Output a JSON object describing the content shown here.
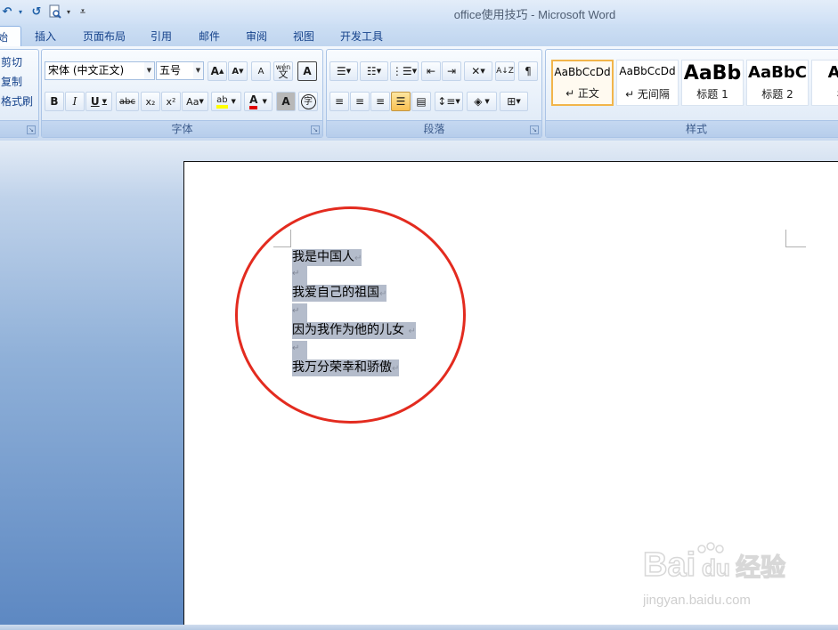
{
  "app": {
    "title": "office使用技巧 - Microsoft Word"
  },
  "tabs": [
    {
      "label": "始"
    },
    {
      "label": "插入"
    },
    {
      "label": "页面布局"
    },
    {
      "label": "引用"
    },
    {
      "label": "邮件"
    },
    {
      "label": "审阅"
    },
    {
      "label": "视图"
    },
    {
      "label": "开发工具"
    }
  ],
  "clipboard": {
    "cut": "剪切",
    "copy": "复制",
    "format_painter": "格式刷"
  },
  "font_group": {
    "label": "字体",
    "font_name": "宋体 (中文正文)",
    "font_size": "五号",
    "grow": "A",
    "shrink": "A",
    "clear_format": "A",
    "phonetic": "wén",
    "bold": "B",
    "italic": "I",
    "underline": "U",
    "strike": "abc",
    "subscript": "x₂",
    "superscript": "x²",
    "change_case": "Aa",
    "highlight": "ab",
    "font_color": "A",
    "char_shading": "A",
    "enclose": "字"
  },
  "paragraph_group": {
    "label": "段落"
  },
  "styles_group": {
    "label": "样式",
    "items": [
      {
        "sample": "AaBbCcDd",
        "name": "↵ 正文"
      },
      {
        "sample": "AaBbCcDd",
        "name": "↵ 无间隔"
      },
      {
        "sample": "AaBb",
        "name": "标题 1"
      },
      {
        "sample": "AaBbC",
        "name": "标题 2"
      },
      {
        "sample": "AaI",
        "name": "标"
      }
    ]
  },
  "document": {
    "lines": [
      "我是中国人",
      "我爱自己的祖国",
      "因为我作为他的儿女 ",
      "我万分荣幸和骄傲"
    ],
    "paragraph_mark": "↵"
  },
  "watermark": {
    "brand": "Bai",
    "brand2": "du",
    "cn": "经验",
    "url": "jingyan.baidu.com"
  },
  "colors": {
    "selection": "#b4bccb",
    "annotation_circle": "#e32b1f",
    "ribbon_text": "#15428b"
  }
}
